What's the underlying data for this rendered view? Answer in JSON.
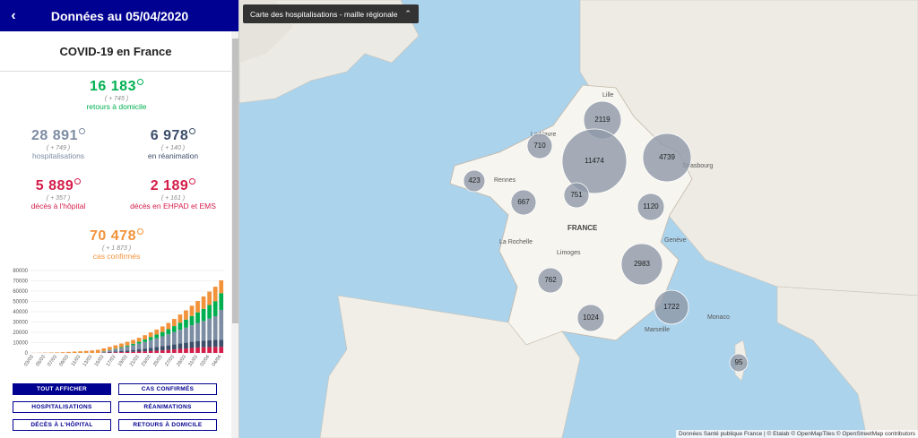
{
  "header": {
    "back_icon": "chevron-left-icon",
    "title": "Données au 05/04/2020"
  },
  "panel_title": "COVID-19 en France",
  "stats": {
    "retours": {
      "value": "16 183",
      "delta": "( + 745 )",
      "label": "retours à domicile",
      "color": "#00b050"
    },
    "hospitalisations": {
      "value": "28 891",
      "delta": "( + 749 )",
      "label": "hospitalisations",
      "color": "#7d8da3"
    },
    "reanimation": {
      "value": "6 978",
      "delta": "( + 140 )",
      "label": "en réanimation",
      "color": "#3d4e6a"
    },
    "deces_hopital": {
      "value": "5 889",
      "delta": "( + 357 )",
      "label": "décès à l'hôpital",
      "color": "#d41e4a"
    },
    "deces_ehpad": {
      "value": "2 189",
      "delta": "( + 161 )",
      "label": "décès en EHPAD et EMS",
      "color": "#d41e4a"
    },
    "confirmes": {
      "value": "70 478",
      "delta": "( + 1 873 )",
      "label": "cas confirmés",
      "color": "#f2923a"
    }
  },
  "chart_data": {
    "type": "bar",
    "stacked": true,
    "categories": [
      "03/03",
      "05/03",
      "07/03",
      "09/03",
      "11/03",
      "13/03",
      "15/03",
      "17/03",
      "19/03",
      "21/03",
      "23/03",
      "25/03",
      "27/03",
      "29/03",
      "31/03",
      "02/04",
      "04/04"
    ],
    "yticks": [
      0,
      10000,
      20000,
      30000,
      40000,
      50000,
      60000,
      70000,
      80000
    ],
    "ylim": [
      0,
      80000
    ],
    "series": [
      {
        "color": "#d41e4a",
        "values": [
          0,
          0,
          0,
          0,
          0,
          0,
          0,
          0,
          0,
          0,
          0,
          0,
          200,
          400,
          600,
          800,
          900,
          1100,
          1300,
          1500,
          1800,
          2100,
          2500,
          2900,
          3400,
          3900,
          4300,
          4800,
          5300,
          5500,
          5700,
          5800,
          5889
        ]
      },
      {
        "color": "#3d4e6a",
        "values": [
          0,
          0,
          0,
          0,
          0,
          0,
          0,
          0,
          0,
          0,
          0,
          0,
          300,
          600,
          900,
          1200,
          1500,
          1800,
          2200,
          2700,
          3200,
          3600,
          4000,
          4400,
          4800,
          5200,
          5600,
          6000,
          6300,
          6500,
          6700,
          6850,
          6978
        ]
      },
      {
        "color": "#7d8da3",
        "values": [
          0,
          0,
          0,
          0,
          0,
          0,
          0,
          0,
          0,
          0,
          0,
          0,
          900,
          1500,
          2200,
          3000,
          3800,
          4600,
          5500,
          6500,
          7500,
          8500,
          9600,
          10800,
          12000,
          13400,
          14600,
          16000,
          17500,
          19000,
          21000,
          23000,
          28891
        ]
      },
      {
        "color": "#00b050",
        "values": [
          0,
          0,
          0,
          0,
          0,
          0,
          0,
          0,
          0,
          0,
          0,
          0,
          200,
          300,
          500,
          700,
          1000,
          1400,
          1800,
          2300,
          2900,
          3600,
          4200,
          5000,
          5800,
          6800,
          7800,
          9000,
          10300,
          11800,
          13100,
          14600,
          16183
        ]
      },
      {
        "color": "#f2923a",
        "values": [
          100,
          200,
          300,
          400,
          500,
          700,
          1000,
          1300,
          1600,
          2000,
          2400,
          3000,
          2800,
          3000,
          3200,
          3400,
          3600,
          3700,
          3900,
          4200,
          4500,
          4900,
          5400,
          6000,
          7000,
          8000,
          9000,
          10000,
          11000,
          12000,
          13000,
          14000,
          12537
        ]
      }
    ]
  },
  "buttons": {
    "tout_afficher": "TOUT AFFICHER",
    "cas_confirmes": "CAS CONFIRMÉS",
    "hospitalisations": "HOSPITALISATIONS",
    "reanimations": "RÉANIMATIONS",
    "deces_hopital": "DÉCÈS À L'HÔPITAL",
    "retours_domicile": "RETOURS À DOMICILE"
  },
  "map": {
    "layer_label": "Carte des hospitalisations - maille régionale",
    "chevron_icon": "chevron-up-icon",
    "country_label": "FRANCE",
    "cities": [
      "Lille",
      "Le Havre",
      "Rennes",
      "Strasbourg",
      "La Rochelle",
      "Limoges",
      "Genève",
      "Marseille",
      "Monaco"
    ],
    "bubbles": [
      "2119",
      "710",
      "11474",
      "4739",
      "423",
      "751",
      "667",
      "1120",
      "2983",
      "762",
      "1722",
      "1024",
      "95"
    ],
    "attribution": "Données Santé publique France | © Etalab © OpenMapTiles © OpenStreetMap contributors"
  }
}
